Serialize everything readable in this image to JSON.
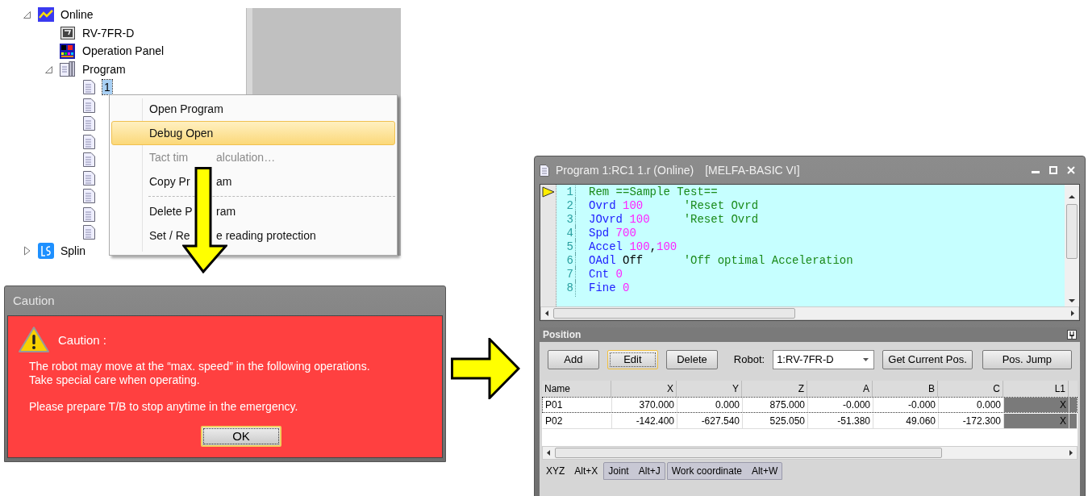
{
  "tree": {
    "items": [
      {
        "label": "Online",
        "kind": "online",
        "expanded": true,
        "children": [
          {
            "label": "RV-7FR-D",
            "kind": "robot"
          },
          {
            "label": "Operation Panel",
            "kind": "panel"
          },
          {
            "label": "Program",
            "kind": "program",
            "expanded": true,
            "children": [
              {
                "label": "1",
                "kind": "file",
                "selected": true
              },
              {
                "kind": "file"
              },
              {
                "kind": "file"
              },
              {
                "kind": "file"
              },
              {
                "kind": "file"
              },
              {
                "kind": "file"
              },
              {
                "kind": "file"
              },
              {
                "kind": "file"
              },
              {
                "kind": "file"
              }
            ]
          }
        ]
      },
      {
        "label": "Splin",
        "kind": "spline",
        "expanded": false
      }
    ]
  },
  "context_menu": {
    "items": [
      {
        "kind": "item",
        "parts": [
          "Open Program"
        ],
        "highlighted": false,
        "disabled": false
      },
      {
        "kind": "item",
        "parts": [
          "Debug Open"
        ],
        "highlighted": true,
        "disabled": false
      },
      {
        "kind": "item",
        "parts": [
          "Tact tim",
          "alculation…"
        ],
        "highlighted": false,
        "disabled": true
      },
      {
        "kind": "item",
        "parts": [
          "Copy Pr",
          "am"
        ],
        "highlighted": false,
        "disabled": false
      },
      {
        "kind": "separator"
      },
      {
        "kind": "item",
        "parts": [
          "Delete P",
          "ram"
        ],
        "highlighted": false,
        "disabled": false
      },
      {
        "kind": "item",
        "parts": [
          "Set / Re",
          "e reading protection"
        ],
        "highlighted": false,
        "disabled": false
      }
    ]
  },
  "caution_dialog": {
    "title": "Caution",
    "heading": "Caution :",
    "paragraphs": [
      [
        "The robot may move at the “max. speed” in the following operations.",
        "Take special care when operating."
      ],
      [
        "Please prepare T/B to stop anytime in the emergency."
      ]
    ],
    "button": {
      "label": "OK",
      "focused": true
    }
  },
  "program_window": {
    "title": "Program 1:RC1 1.r (Online)",
    "language": "[MELFA-BASIC VI]",
    "code_lines": [
      {
        "number": "1",
        "current": true,
        "tokens": [
          {
            "kind": "comment",
            "text": "Rem ==Sample Test=="
          }
        ]
      },
      {
        "number": "2",
        "tokens": [
          {
            "kind": "keyword",
            "text": "Ovrd"
          },
          {
            "kind": "number",
            "text": " 100"
          },
          {
            "kind": "comment",
            "text": "      'Reset Ovrd"
          }
        ]
      },
      {
        "number": "3",
        "tokens": [
          {
            "kind": "keyword",
            "text": "JOvrd"
          },
          {
            "kind": "number",
            "text": " 100"
          },
          {
            "kind": "comment",
            "text": "     'Reset Ovrd"
          }
        ]
      },
      {
        "number": "4",
        "tokens": [
          {
            "kind": "keyword",
            "text": "Spd"
          },
          {
            "kind": "number",
            "text": " 700"
          }
        ]
      },
      {
        "number": "5",
        "tokens": [
          {
            "kind": "keyword",
            "text": "Accel"
          },
          {
            "kind": "number",
            "text": " 100"
          },
          {
            "kind": "plain",
            "text": ","
          },
          {
            "kind": "number",
            "text": "100"
          }
        ]
      },
      {
        "number": "6",
        "tokens": [
          {
            "kind": "keyword",
            "text": "OAdl"
          },
          {
            "kind": "plain",
            "text": " Off"
          },
          {
            "kind": "comment",
            "text": "      'Off optimal Acceleration"
          }
        ]
      },
      {
        "number": "7",
        "tokens": [
          {
            "kind": "keyword",
            "text": "Cnt"
          },
          {
            "kind": "number",
            "text": " 0"
          }
        ]
      },
      {
        "number": "8",
        "tokens": [
          {
            "kind": "keyword",
            "text": "Fine"
          },
          {
            "kind": "number",
            "text": " 0"
          }
        ]
      }
    ]
  },
  "position_panel": {
    "title": "Position",
    "buttons": [
      {
        "label": "Add",
        "focused": false
      },
      {
        "label": "Edit",
        "focused": true
      },
      {
        "label": "Delete",
        "focused": false
      }
    ],
    "robot_label": "Robot:",
    "robot_value": "1:RV-7FR-D",
    "action_buttons": [
      "Get Current Pos.",
      "Pos. Jump"
    ],
    "table": {
      "columns": [
        "Name",
        "X",
        "Y",
        "Z",
        "A",
        "B",
        "C",
        "L1"
      ],
      "rows": [
        {
          "selected": true,
          "cells": [
            "P01",
            "370.000",
            "0.000",
            "875.000",
            "-0.000",
            "-0.000",
            "0.000",
            "X"
          ]
        },
        {
          "selected": false,
          "cells": [
            "P02",
            "-142.400",
            "-627.540",
            "525.050",
            "-51.380",
            "49.060",
            "-172.300",
            "X"
          ]
        }
      ]
    },
    "tabs": [
      {
        "label": "XYZ",
        "shortcut": "Alt+X",
        "selected": true
      },
      {
        "label": "Joint",
        "shortcut": "Alt+J",
        "selected": false
      },
      {
        "label": "Work coordinate",
        "shortcut": "Alt+W",
        "selected": false
      }
    ]
  }
}
